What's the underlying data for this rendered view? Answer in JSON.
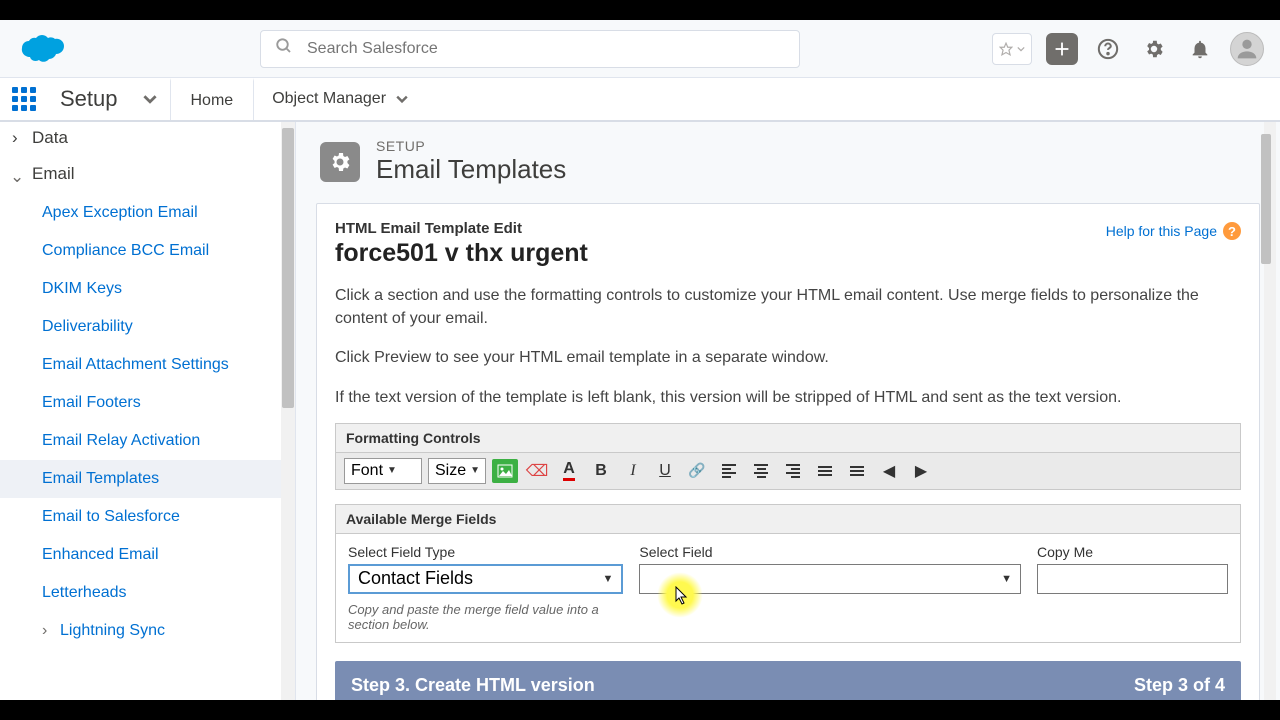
{
  "search": {
    "placeholder": "Search Salesforce"
  },
  "nav": {
    "app": "Setup",
    "home": "Home",
    "objmgr": "Object Manager"
  },
  "sidebar": {
    "data": "Data",
    "email": "Email",
    "items": [
      "Apex Exception Email",
      "Compliance BCC Email",
      "DKIM Keys",
      "Deliverability",
      "Email Attachment Settings",
      "Email Footers",
      "Email Relay Activation",
      "Email Templates",
      "Email to Salesforce",
      "Enhanced Email",
      "Letterheads"
    ],
    "lightning": "Lightning Sync"
  },
  "page": {
    "crumb": "SETUP",
    "title": "Email Templates"
  },
  "panel": {
    "subhead": "HTML Email Template Edit",
    "tname": "force501 v thx urgent",
    "help": "Help for this Page",
    "desc1": "Click a section and use the formatting controls to customize your HTML email content. Use merge fields to personalize the content of your email.",
    "desc2": "Click Preview to see your HTML email template in a separate window.",
    "desc3": "If the text version of the template is left blank, this version will be stripped of HTML and sent as the text version."
  },
  "fc": {
    "title": "Formatting Controls",
    "font": "Font",
    "size": "Size"
  },
  "merge": {
    "title": "Available Merge Fields",
    "type_label": "Select Field Type",
    "type_value": "Contact Fields",
    "field_label": "Select Field",
    "copy_label": "Copy Me",
    "hint": "Copy and paste the merge field value into a section below."
  },
  "step": {
    "title": "Step 3. Create HTML version",
    "num": "Step 3 of 4"
  }
}
